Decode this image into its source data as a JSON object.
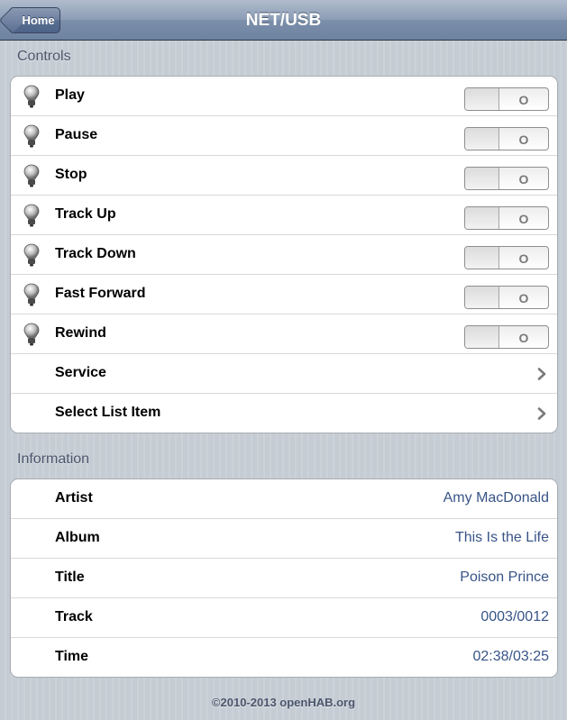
{
  "header": {
    "title": "NET/USB",
    "home_label": "Home"
  },
  "controls": {
    "section_title": "Controls",
    "switches": [
      {
        "label": "Play",
        "state": "O"
      },
      {
        "label": "Pause",
        "state": "O"
      },
      {
        "label": "Stop",
        "state": "O"
      },
      {
        "label": "Track Up",
        "state": "O"
      },
      {
        "label": "Track Down",
        "state": "O"
      },
      {
        "label": "Fast Forward",
        "state": "O"
      },
      {
        "label": "Rewind",
        "state": "O"
      }
    ],
    "links": [
      {
        "label": "Service"
      },
      {
        "label": "Select List Item"
      }
    ]
  },
  "information": {
    "section_title": "Information",
    "items": [
      {
        "label": "Artist",
        "value": "Amy MacDonald"
      },
      {
        "label": "Album",
        "value": "This Is the Life"
      },
      {
        "label": "Title",
        "value": "Poison Prince"
      },
      {
        "label": "Track",
        "value": "0003/0012"
      },
      {
        "label": "Time",
        "value": "02:38/03:25"
      }
    ]
  },
  "footer": {
    "copyright": "©2010-2013 openHAB.org"
  },
  "colors": {
    "value_text": "#385487",
    "section_text": "#4c566c",
    "navbar": "#6d83a1"
  },
  "icons": {
    "switch_item": "lightbulb-icon",
    "link_item": "chevron-right-icon"
  }
}
